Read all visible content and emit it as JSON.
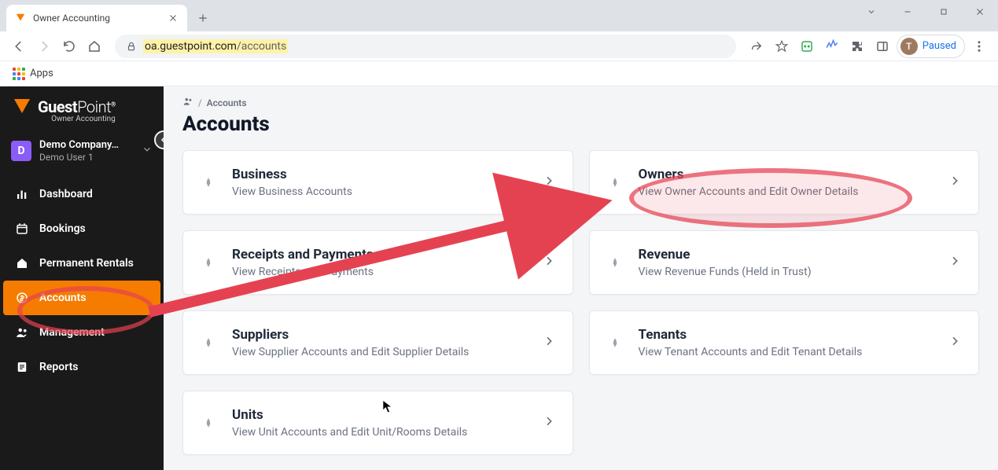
{
  "browser": {
    "tab_title": "Owner Accounting",
    "url_host": "oa.guestpoint.com",
    "url_path": "/accounts",
    "apps_label": "Apps",
    "paused_label": "Paused",
    "avatar_letter": "T"
  },
  "brand": {
    "name_strong": "Guest",
    "name_thin": "Point",
    "subtitle": "Owner Accounting"
  },
  "company": {
    "badge": "D",
    "name": "Demo Company…",
    "user": "Demo User 1"
  },
  "sidebar": {
    "items": [
      {
        "label": "Dashboard"
      },
      {
        "label": "Bookings"
      },
      {
        "label": "Permanent Rentals"
      },
      {
        "label": "Accounts"
      },
      {
        "label": "Management"
      },
      {
        "label": "Reports"
      }
    ]
  },
  "breadcrumb": {
    "root_icon": "users",
    "current": "Accounts"
  },
  "page": {
    "title": "Accounts"
  },
  "cards": [
    {
      "title": "Business",
      "desc": "View Business Accounts"
    },
    {
      "title": "Owners",
      "desc": "View Owner Accounts and Edit Owner Details"
    },
    {
      "title": "Receipts and Payments",
      "desc": "View Receipts and Payments"
    },
    {
      "title": "Revenue",
      "desc": "View Revenue Funds (Held in Trust)"
    },
    {
      "title": "Suppliers",
      "desc": "View Supplier Accounts and Edit Supplier Details"
    },
    {
      "title": "Tenants",
      "desc": "View Tenant Accounts and Edit Tenant Details"
    },
    {
      "title": "Units",
      "desc": "View Unit Accounts and Edit Unit/Rooms Details"
    }
  ],
  "annotations": {
    "highlight_sidebar": "Accounts",
    "highlight_card": "Owners",
    "arrow": true
  }
}
